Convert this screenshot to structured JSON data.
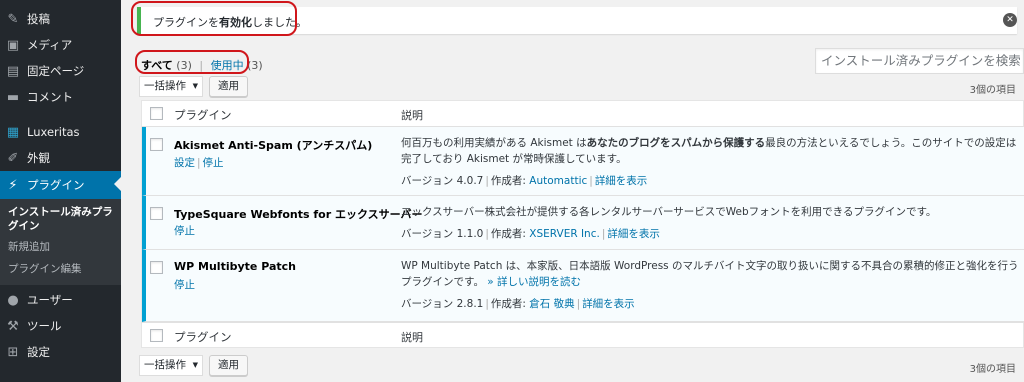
{
  "sidebar": {
    "items": [
      {
        "label": "投稿",
        "icon": "pin-icon",
        "glyph": "✎"
      },
      {
        "label": "メディア",
        "icon": "media-icon",
        "glyph": "▣"
      },
      {
        "label": "固定ページ",
        "icon": "page-icon",
        "glyph": "▤"
      },
      {
        "label": "コメント",
        "icon": "comment-icon",
        "glyph": "▬"
      },
      {
        "label": "Luxeritas",
        "icon": "grid-icon",
        "glyph": "▦"
      },
      {
        "label": "外観",
        "icon": "brush-icon",
        "glyph": "✐"
      },
      {
        "label": "プラグイン",
        "icon": "plugin-icon",
        "glyph": "⚡"
      },
      {
        "label": "ユーザー",
        "icon": "user-icon",
        "glyph": "●"
      },
      {
        "label": "ツール",
        "icon": "wrench-icon",
        "glyph": "⚒"
      },
      {
        "label": "設定",
        "icon": "settings-icon",
        "glyph": "⊞"
      }
    ],
    "submenu": [
      "インストール済みプラグイン",
      "新規追加",
      "プラグイン編集"
    ]
  },
  "notice": {
    "prefix": "プラグインを",
    "bold": "有効化",
    "suffix": "しました。",
    "dismiss_glyph": "✕"
  },
  "filters": {
    "all_label": "すべて",
    "all_count": "(3)",
    "active_label": "使用中",
    "active_count": "(3)",
    "separator": "|"
  },
  "search": {
    "placeholder": "インストール済みプラグインを検索"
  },
  "bulk": {
    "select_label": "一括操作",
    "caret": "▼",
    "apply_label": "適用",
    "items_count": "3個の項目"
  },
  "table": {
    "col_plugin": "プラグイン",
    "col_desc": "説明",
    "rows": [
      {
        "name": "Akismet Anti-Spam (アンチスパム)",
        "actions": [
          "設定",
          "停止"
        ],
        "desc_pre": "何百万もの利用実績がある Akismet は",
        "desc_bold": "あなたのブログをスパムから保護する",
        "desc_post": "最良の方法といえるでしょう。このサイトでの設定は完了しており Akismet が常時保護しています。",
        "version": "バージョン 4.0.7",
        "author_label": "作成者:",
        "author": "Automattic",
        "details": "詳細を表示"
      },
      {
        "name": "TypeSquare Webfonts for エックスサーバー",
        "actions": [
          "停止"
        ],
        "desc": "エックスサーバー株式会社が提供する各レンタルサーバーサービスでWebフォントを利用できるプラグインです。",
        "version": "バージョン 1.1.0",
        "author_label": "作成者:",
        "author": "XSERVER Inc.",
        "details": "詳細を表示"
      },
      {
        "name": "WP Multibyte Patch",
        "actions": [
          "停止"
        ],
        "desc": "WP Multibyte Patch は、本家版、日本語版 WordPress のマルチバイト文字の取り扱いに関する不具合の累積的修正と強化を行うプラグインです。",
        "more_link": "» 詳しい説明を読む",
        "version": "バージョン 2.8.1",
        "author_label": "作成者:",
        "author": "倉石 敬典",
        "details": "詳細を表示"
      }
    ]
  }
}
